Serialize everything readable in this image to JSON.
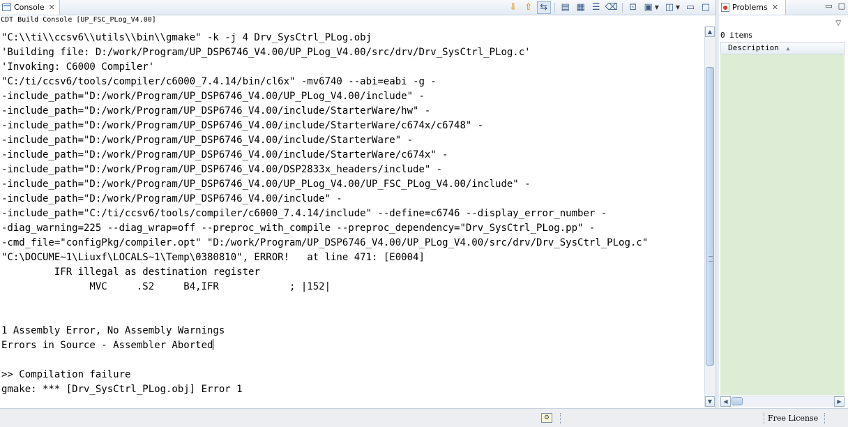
{
  "console": {
    "tab_label": "Console",
    "subtitle": "CDT Build Console [UP_FSC_PLog_V4.00]",
    "lines": [
      "\"C:\\\\ti\\\\ccsv6\\\\utils\\\\bin\\\\gmake\" -k -j 4 Drv_SysCtrl_PLog.obj",
      "'Building file: D:/work/Program/UP_DSP6746_V4.00/UP_PLog_V4.00/src/drv/Drv_SysCtrl_PLog.c'",
      "'Invoking: C6000 Compiler'",
      "\"C:/ti/ccsv6/tools/compiler/c6000_7.4.14/bin/cl6x\" -mv6740 --abi=eabi -g -",
      "-include_path=\"D:/work/Program/UP_DSP6746_V4.00/UP_PLog_V4.00/include\" -",
      "-include_path=\"D:/work/Program/UP_DSP6746_V4.00/include/StarterWare/hw\" -",
      "-include_path=\"D:/work/Program/UP_DSP6746_V4.00/include/StarterWare/c674x/c6748\" -",
      "-include_path=\"D:/work/Program/UP_DSP6746_V4.00/include/StarterWare\" -",
      "-include_path=\"D:/work/Program/UP_DSP6746_V4.00/include/StarterWare/c674x\" -",
      "-include_path=\"D:/work/Program/UP_DSP6746_V4.00/DSP2833x_headers/include\" -",
      "-include_path=\"D:/work/Program/UP_DSP6746_V4.00/UP_PLog_V4.00/UP_FSC_PLog_V4.00/include\" -",
      "-include_path=\"D:/work/Program/UP_DSP6746_V4.00/include\" -",
      "-include_path=\"C:/ti/ccsv6/tools/compiler/c6000_7.4.14/include\" --define=c6746 --display_error_number -",
      "-diag_warning=225 --diag_wrap=off --preproc_with_compile --preproc_dependency=\"Drv_SysCtrl_PLog.pp\" -",
      "-cmd_file=\"configPkg/compiler.opt\" \"D:/work/Program/UP_DSP6746_V4.00/UP_PLog_V4.00/src/drv/Drv_SysCtrl_PLog.c\"",
      "\"C:\\DOCUME~1\\Liuxf\\LOCALS~1\\Temp\\0380810\", ERROR!   at line 471: [E0004]",
      "         IFR illegal as destination register",
      "               MVC     .S2     B4,IFR            ; |152|",
      "",
      "",
      "1 Assembly Error, No Assembly Warnings",
      "Errors in Source - Assembler Aborted",
      "",
      ">> Compilation failure",
      "gmake: *** [Drv_SysCtrl_PLog.obj] Error 1"
    ]
  },
  "problems": {
    "tab_label": "Problems",
    "items_count": "0 items",
    "column_description": "Description"
  },
  "statusbar": {
    "license": "Free License"
  },
  "icons": {
    "console_tab": "console-icon",
    "problems_tab": "problems-icon",
    "close": "close-icon"
  }
}
